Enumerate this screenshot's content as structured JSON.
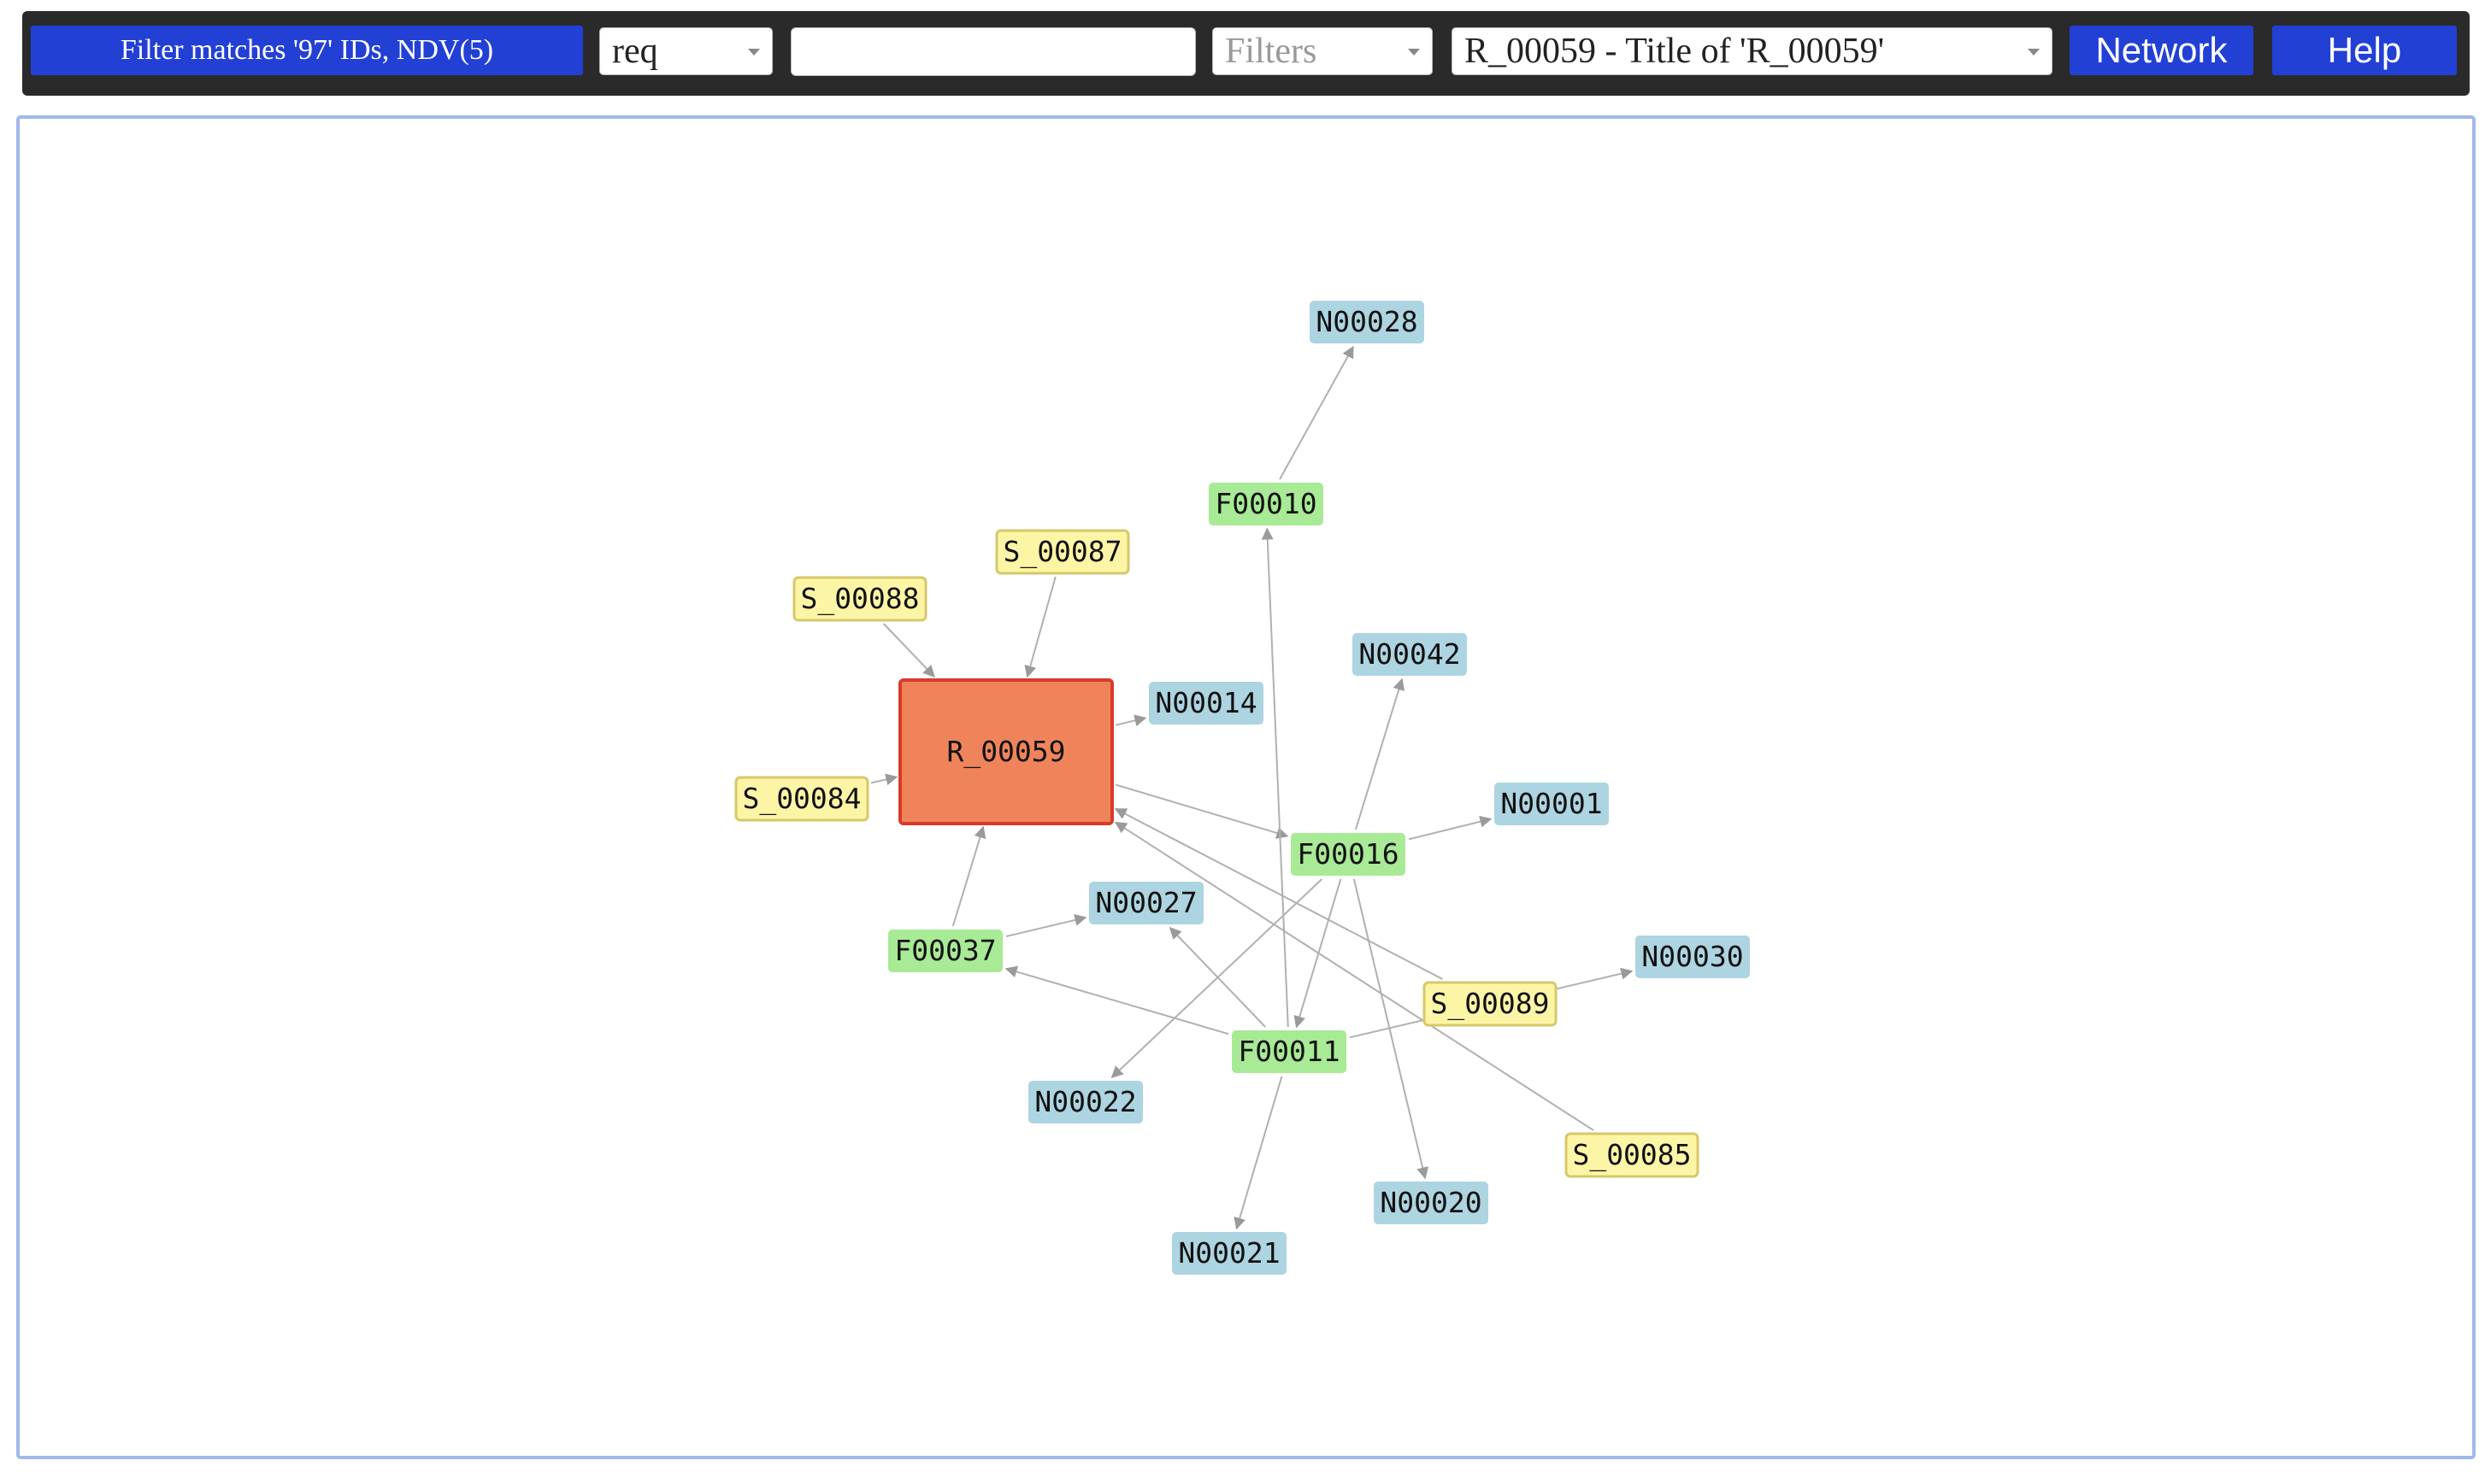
{
  "toolbar": {
    "filter_button": "Filter matches '97' IDs, NDV(5)",
    "type_select_value": "req",
    "search_value": "",
    "filters_placeholder": "Filters",
    "node_select_value": "R_00059 - Title of 'R_00059'",
    "network_button": "Network",
    "help_button": "Help"
  },
  "colors": {
    "requirement_fill": "#ef845b",
    "requirement_border": "#d93a2b",
    "spec_fill": "#fdf5a6",
    "spec_border": "#d6c86a",
    "feature_fill": "#a8ea95",
    "note_fill": "#add4e1",
    "button_blue": "#2340d4",
    "toolbar_bg": "#2a2a2a",
    "canvas_border": "#a3b8eb"
  },
  "graph": {
    "nodes": [
      {
        "id": "R_00059",
        "type": "requirement"
      },
      {
        "id": "S_00088",
        "type": "spec"
      },
      {
        "id": "S_00087",
        "type": "spec"
      },
      {
        "id": "S_00084",
        "type": "spec"
      },
      {
        "id": "S_00089",
        "type": "spec"
      },
      {
        "id": "S_00085",
        "type": "spec"
      },
      {
        "id": "F00010",
        "type": "feature"
      },
      {
        "id": "F00016",
        "type": "feature"
      },
      {
        "id": "F00037",
        "type": "feature"
      },
      {
        "id": "F00011",
        "type": "feature"
      },
      {
        "id": "N00028",
        "type": "note"
      },
      {
        "id": "N00042",
        "type": "note"
      },
      {
        "id": "N00014",
        "type": "note"
      },
      {
        "id": "N00001",
        "type": "note"
      },
      {
        "id": "N00027",
        "type": "note"
      },
      {
        "id": "N00030",
        "type": "note"
      },
      {
        "id": "N00022",
        "type": "note"
      },
      {
        "id": "N00020",
        "type": "note"
      },
      {
        "id": "N00021",
        "type": "note"
      }
    ],
    "edges": [
      {
        "from": "S_00088",
        "to": "R_00059"
      },
      {
        "from": "S_00087",
        "to": "R_00059"
      },
      {
        "from": "S_00084",
        "to": "R_00059"
      },
      {
        "from": "R_00059",
        "to": "N00014"
      },
      {
        "from": "R_00059",
        "to": "F00016"
      },
      {
        "from": "S_00089",
        "to": "R_00059"
      },
      {
        "from": "S_00085",
        "to": "R_00059"
      },
      {
        "from": "F00037",
        "to": "R_00059"
      },
      {
        "from": "F00010",
        "to": "N00028"
      },
      {
        "from": "F00011",
        "to": "F00010"
      },
      {
        "from": "F00016",
        "to": "N00042"
      },
      {
        "from": "F00016",
        "to": "N00001"
      },
      {
        "from": "F00016",
        "to": "N00022"
      },
      {
        "from": "F00016",
        "to": "F00011"
      },
      {
        "from": "F00016",
        "to": "N00020"
      },
      {
        "from": "F00037",
        "to": "N00027"
      },
      {
        "from": "F00011",
        "to": "N00027"
      },
      {
        "from": "F00011",
        "to": "F00037"
      },
      {
        "from": "F00011",
        "to": "N00021"
      },
      {
        "from": "F00011",
        "to": "N00030"
      }
    ]
  }
}
